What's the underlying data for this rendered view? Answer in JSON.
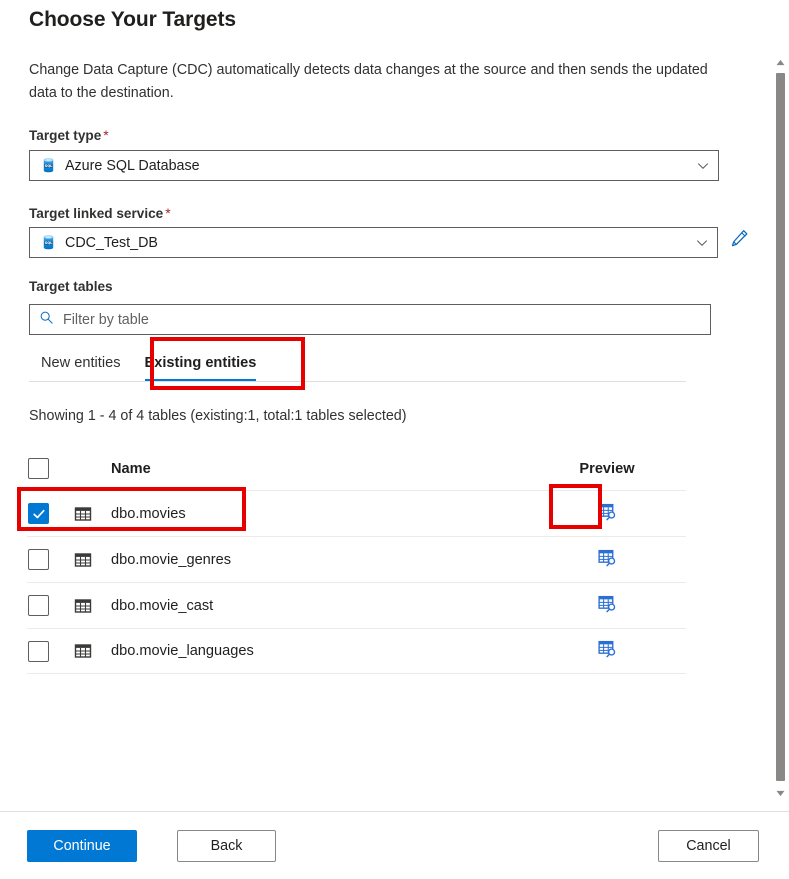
{
  "page": {
    "title": "Choose Your Targets",
    "description": "Change Data Capture (CDC) automatically detects data changes at the source and then sends the updated data to the destination."
  },
  "target_type": {
    "label": "Target type",
    "required_marker": "*",
    "value": "Azure SQL Database",
    "icon": "azure-sql-database-icon",
    "chevron": "chevron-down-icon"
  },
  "target_linked_service": {
    "label": "Target linked service",
    "required_marker": "*",
    "value": "CDC_Test_DB",
    "icon": "azure-sql-database-icon",
    "chevron": "chevron-down-icon",
    "edit_icon": "pencil-icon"
  },
  "target_tables": {
    "label": "Target tables",
    "search_placeholder": "Filter by table",
    "search_value": "",
    "search_icon": "search-icon"
  },
  "tabs": [
    {
      "label": "New entities",
      "active": false
    },
    {
      "label": "Existing entities",
      "active": true
    }
  ],
  "showing_text": "Showing 1 - 4 of 4 tables (existing:1, total:1 tables selected)",
  "table": {
    "columns": {
      "select_all": "",
      "name": "Name",
      "preview": "Preview"
    },
    "select_all_checked": false,
    "rows": [
      {
        "name": "dbo.movies",
        "checked": true,
        "icon": "table-icon",
        "preview_icon": "table-preview-icon"
      },
      {
        "name": "dbo.movie_genres",
        "checked": false,
        "icon": "table-icon",
        "preview_icon": "table-preview-icon"
      },
      {
        "name": "dbo.movie_cast",
        "checked": false,
        "icon": "table-icon",
        "preview_icon": "table-preview-icon"
      },
      {
        "name": "dbo.movie_languages",
        "checked": false,
        "icon": "table-icon",
        "preview_icon": "table-preview-icon"
      }
    ]
  },
  "scrollbar": {
    "up_icon": "scroll-up-arrow-icon",
    "down_icon": "scroll-down-arrow-icon"
  },
  "footer": {
    "continue_label": "Continue",
    "back_label": "Back",
    "cancel_label": "Cancel"
  },
  "annotations": {
    "highlight_color": "#e60000",
    "boxes": [
      {
        "name": "existing-entities-tab-highlight"
      },
      {
        "name": "selected-row-highlight"
      },
      {
        "name": "preview-icon-highlight"
      }
    ]
  },
  "colors": {
    "accent_blue": "#0078d4",
    "text_primary": "#201f1e",
    "border": "#605e5c",
    "highlight_red": "#e60000"
  }
}
